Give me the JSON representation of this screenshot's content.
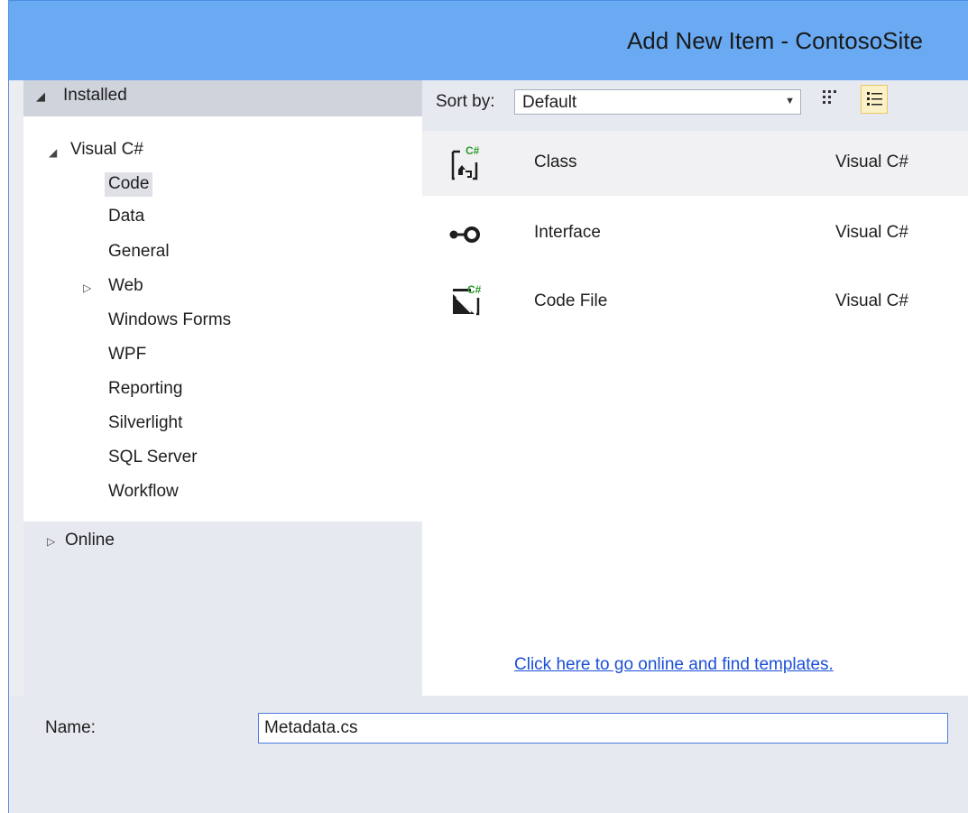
{
  "window": {
    "title": "Add New Item - ContosoSite"
  },
  "left": {
    "installed_label": "Installed",
    "installed_arrow": "◢",
    "tree_root": {
      "label": "Visual C#",
      "arrow": "◢"
    },
    "tree_children": [
      {
        "label": "Code",
        "selected": true
      },
      {
        "label": "Data"
      },
      {
        "label": "General"
      },
      {
        "label": "Web",
        "expandable": true,
        "arrow": "▷"
      },
      {
        "label": "Windows Forms"
      },
      {
        "label": "WPF"
      },
      {
        "label": "Reporting"
      },
      {
        "label": "Silverlight"
      },
      {
        "label": "SQL Server"
      },
      {
        "label": "Workflow"
      }
    ],
    "online_label": "Online",
    "online_arrow": "▷"
  },
  "toolbar": {
    "sort_label": "Sort by:",
    "sort_value": "Default",
    "dropdown_arrow": "▼",
    "grid_view_icon": "medium-icons-view-icon",
    "list_view_icon": "list-view-icon"
  },
  "items": [
    {
      "name": "Class",
      "language": "Visual C#",
      "icon": "csharp-class-icon",
      "selected": true
    },
    {
      "name": "Interface",
      "language": "Visual C#",
      "icon": "interface-icon"
    },
    {
      "name": "Code File",
      "language": "Visual C#",
      "icon": "csharp-code-file-icon"
    }
  ],
  "online_link": "Click here to go online and find templates.",
  "bottom": {
    "name_label": "Name:",
    "name_value": "Metadata.cs"
  },
  "colors": {
    "titlebar": "#6aaaf3",
    "link": "#1a4fd6",
    "csharp_green": "#2a9d2a"
  }
}
